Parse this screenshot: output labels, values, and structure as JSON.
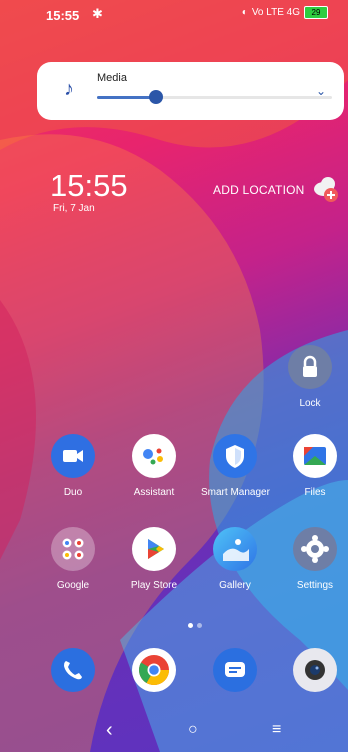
{
  "status_bar": {
    "time": "15:55",
    "settings_glyph": "✱",
    "network": "Vo LTE 4G",
    "battery": "29"
  },
  "media_panel": {
    "label": "Media",
    "volume_percent": 25
  },
  "clock": {
    "time": "15:55",
    "date": "Fri, 7 Jan"
  },
  "weather": {
    "add_location": "ADD LOCATION"
  },
  "apps": [
    {
      "label": "Lock"
    },
    {
      "label": "Duo"
    },
    {
      "label": "Assistant"
    },
    {
      "label": "Smart Manager"
    },
    {
      "label": "Files"
    },
    {
      "label": "Google"
    },
    {
      "label": "Play Store"
    },
    {
      "label": "Gallery"
    },
    {
      "label": "Settings"
    }
  ],
  "page_indicator": {
    "pages": 2,
    "current": 1
  },
  "colors": {
    "accent": "#2b56a8",
    "duo": "#2f6fe2",
    "phone": "#2b6fe0",
    "messages": "#2b6fe0"
  }
}
